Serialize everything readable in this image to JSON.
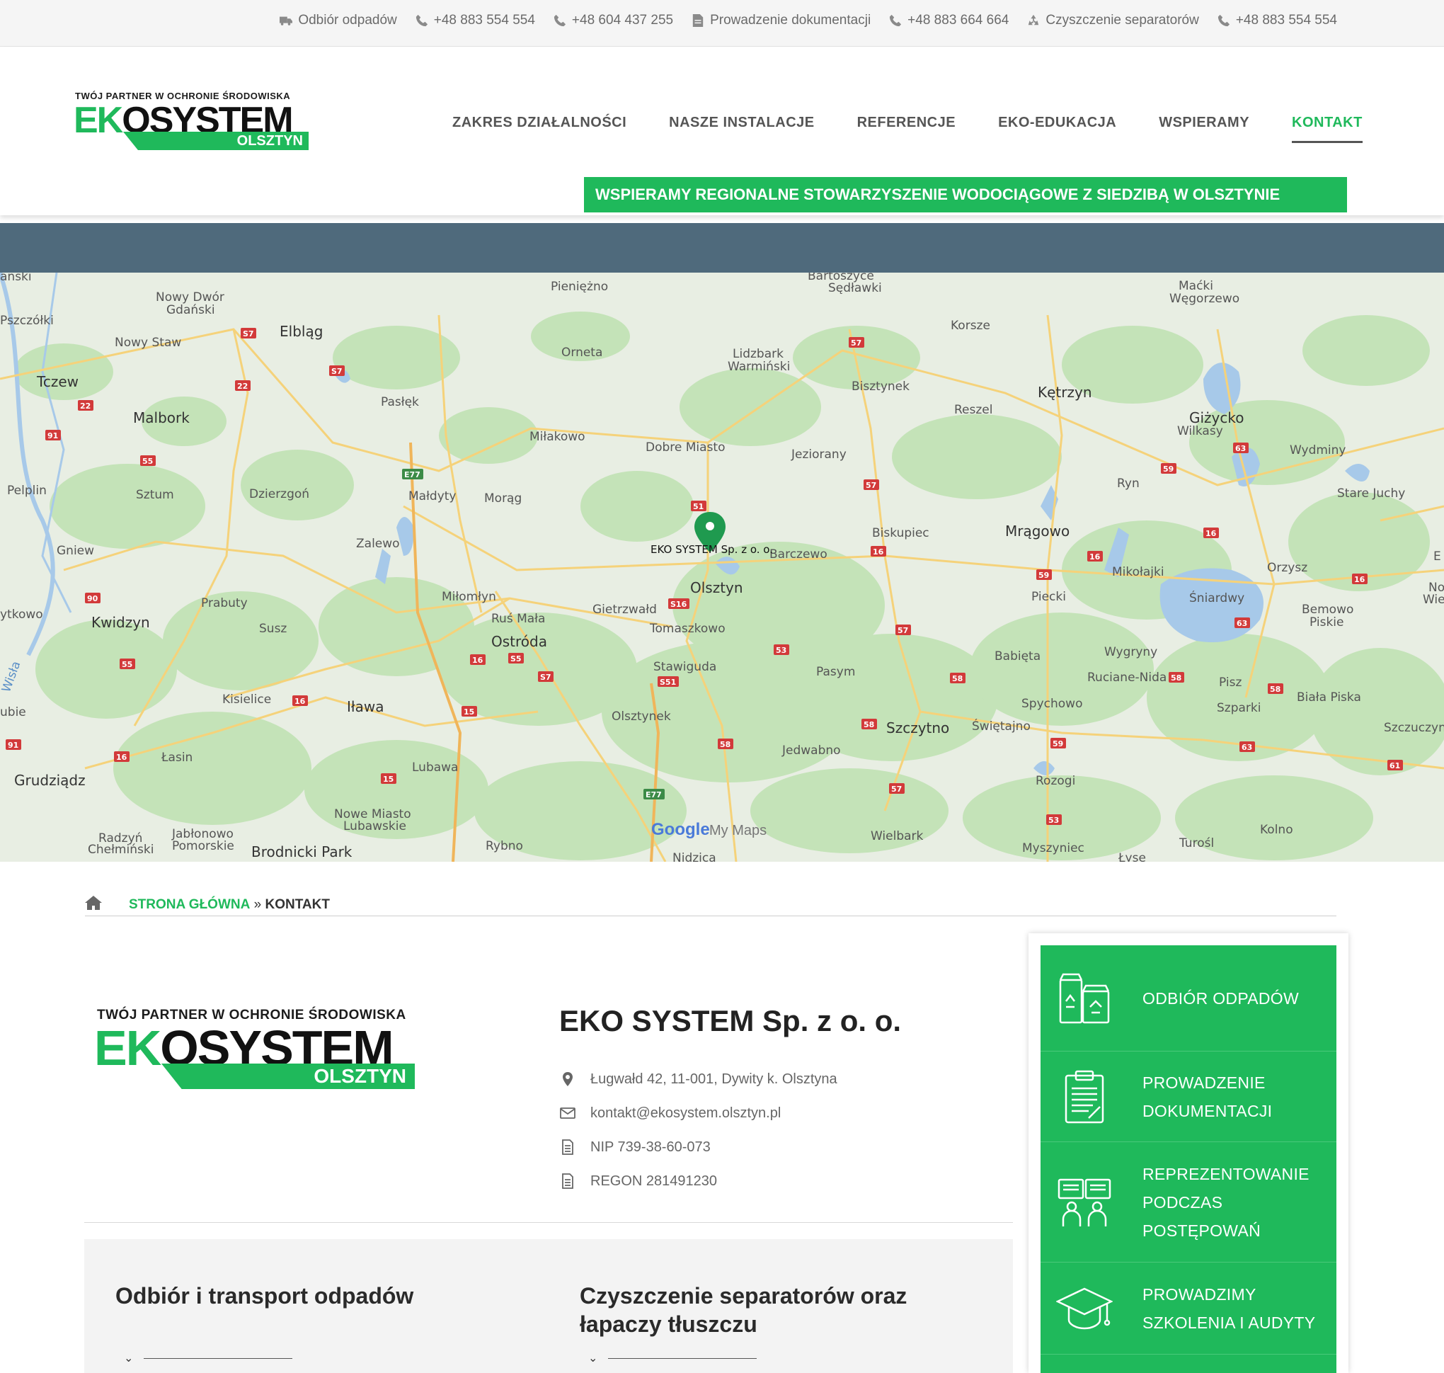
{
  "topbar": {
    "items": [
      {
        "icon": "truck-icon",
        "label": "Odbiór odpadów"
      },
      {
        "icon": "phone-icon",
        "label": "+48 883 554 554"
      },
      {
        "icon": "phone-icon",
        "label": "+48 604 437 255"
      },
      {
        "icon": "document-icon",
        "label": "Prowadzenie dokumentacji"
      },
      {
        "icon": "phone-icon",
        "label": "+48 883 664 664"
      },
      {
        "icon": "recycle-icon",
        "label": "Czyszczenie separatorów"
      },
      {
        "icon": "phone-icon",
        "label": "+48 883 554 554"
      }
    ]
  },
  "logo": {
    "tagline": "TWÓJ PARTNER W OCHRONIE ŚRODOWISKA",
    "name_accent": "EK",
    "name_rest": "OSYSTEM",
    "city": "OLSZTYN"
  },
  "nav": {
    "items": [
      "ZAKRES DZIAŁALNOŚCI",
      "NASZE INSTALACJE",
      "REFERENCJE",
      "EKO-EDUKACJA",
      "WSPIERAMY",
      "KONTAKT"
    ],
    "active": "KONTAKT"
  },
  "announcement": "WSPIERAMY REGIONALNE STOWARZYSZENIE WODOCIĄGOWE Z SIEDZIBĄ W OLSZTYNIE",
  "map": {
    "marker_label": "EKO SYSTEM Sp. z o. o.",
    "provider_google": "Google",
    "provider_product": "My Maps",
    "places": [
      "Pieniężno",
      "Bartoszyce",
      "Sędławki",
      "Maćki",
      "Węgorzewo",
      "Nowy Dwór Gdański",
      "Pszczółki",
      "Elbląg",
      "Korsze",
      "Nowy Staw",
      "Lidzbark Warmiński",
      "Orneta",
      "Tczew",
      "Bisztynek",
      "Kętrzyn",
      "Pasłęk",
      "Reszel",
      "Malbork",
      "Giżycko",
      "Wilkasy",
      "Miłakowo",
      "Dobre Miasto",
      "Jeziorany",
      "Wydminy",
      "Pelplin",
      "Sztum",
      "Dzierzgoń",
      "Małdyty",
      "Morąg",
      "Ryn",
      "Stare Juchy",
      "Biskupiec",
      "Mrągowo",
      "Gniew",
      "Zalewo",
      "Barczewo",
      "Mikołajki",
      "Orzysz",
      "Olsztyn",
      "Miłomłyn",
      "Piecki",
      "Śniardwy",
      "Bemowo Piskie",
      "Kwidzyn",
      "Prabuty",
      "Gietrzwałd",
      "Ruś Mała",
      "Susz",
      "Tomaszkowo",
      "Ostróda",
      "Wygryny",
      "Babięta",
      "Stawiguda",
      "Pasym",
      "Ruciane-Nida",
      "Pisz",
      "Kisielice",
      "Iława",
      "Spychowo",
      "Szparki",
      "Biała Piska",
      "Olsztynek",
      "Szczytno",
      "Świętajno",
      "Grudziądz",
      "Łasin",
      "Jedwabno",
      "Lubawa",
      "Rozogi",
      "Nowe Miasto Lubawskie",
      "Radzyń Chełmiński",
      "Jabłonowo Pomorskie",
      "Brodnicki Park",
      "Rybno",
      "Wielbark",
      "Myszyniec",
      "Turośl",
      "Kolno",
      "Szczuczyn",
      "Wisła"
    ],
    "roads": [
      "S7",
      "S7",
      "22",
      "91",
      "22",
      "55",
      "E77",
      "57",
      "57",
      "59",
      "63",
      "51",
      "16",
      "16",
      "16",
      "59",
      "16",
      "90",
      "S16",
      "16",
      "S5",
      "57",
      "63",
      "55",
      "S7",
      "53",
      "58",
      "S51",
      "15",
      "16",
      "58",
      "58",
      "59",
      "91",
      "16",
      "58",
      "63",
      "15",
      "57",
      "E77",
      "53",
      "61"
    ]
  },
  "breadcrumb": {
    "home_icon": "home-icon",
    "link": "STRONA GŁÓWNA",
    "separator": "»",
    "current": "KONTAKT"
  },
  "company": {
    "name": "EKO SYSTEM Sp. z o. o.",
    "address": "Ługwałd 42, 11-001, Dywity k. Olsztyna",
    "email": "kontakt@ekosystem.olsztyn.pl",
    "nip": "NIP 739-38-60-073",
    "regon": "REGON 281491230"
  },
  "services": [
    {
      "title": "Odbiór i transport odpadów"
    },
    {
      "title": "Czyszczenie separatorów oraz łapaczy tłuszczu"
    }
  ],
  "sidebar": {
    "items": [
      {
        "icon": "waste-bins-icon",
        "label": "ODBIÓR ODPADÓW"
      },
      {
        "icon": "clipboard-icon",
        "label": "PROWADZENIE DOKUMENTACJI"
      },
      {
        "icon": "meeting-icon",
        "label": "REPREZENTOWANIE PODCZAS POSTĘPOWAŃ"
      },
      {
        "icon": "graduation-cap-icon",
        "label": "PROWADZIMY SZKOLENIA I AUDYTY"
      }
    ]
  },
  "colors": {
    "accent": "#1fb95b",
    "strip": "#4f6a7c",
    "map_land": "#e9f0e4"
  }
}
